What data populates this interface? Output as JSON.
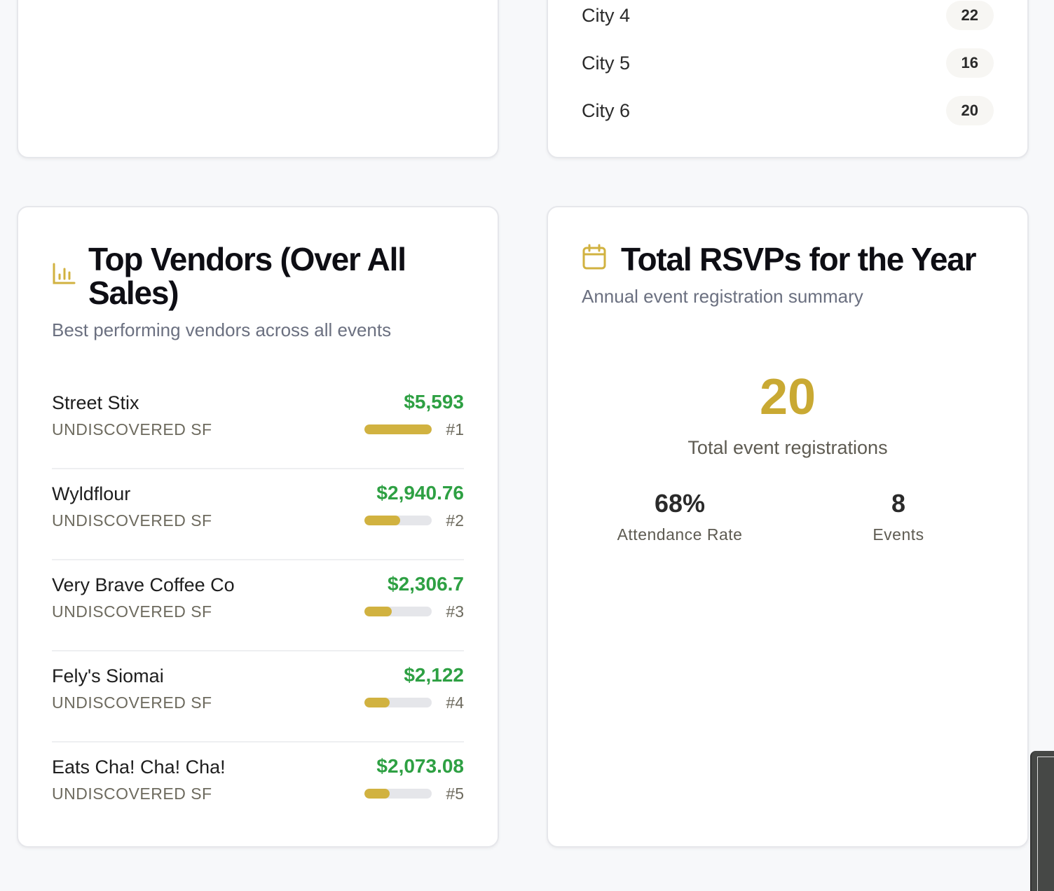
{
  "cities": [
    {
      "name": "City 4",
      "count": "22"
    },
    {
      "name": "City 5",
      "count": "16"
    },
    {
      "name": "City 6",
      "count": "20"
    }
  ],
  "vendors": {
    "title": "Top Vendors (Over All Sales)",
    "subtitle": "Best performing vendors across all events",
    "icon": "bar-chart-icon",
    "accent": "#d1b240",
    "items": [
      {
        "name": "Street Stix",
        "org": "UNDISCOVERED SF",
        "amount": "$5,593",
        "rank": "#1",
        "share": 1.0
      },
      {
        "name": "Wyldflour",
        "org": "UNDISCOVERED SF",
        "amount": "$2,940.76",
        "rank": "#2",
        "share": 0.53
      },
      {
        "name": "Very Brave Coffee Co",
        "org": "UNDISCOVERED SF",
        "amount": "$2,306.7",
        "rank": "#3",
        "share": 0.41
      },
      {
        "name": "Fely's Siomai",
        "org": "UNDISCOVERED SF",
        "amount": "$2,122",
        "rank": "#4",
        "share": 0.38
      },
      {
        "name": "Eats Cha! Cha! Cha!",
        "org": "UNDISCOVERED SF",
        "amount": "$2,073.08",
        "rank": "#5",
        "share": 0.37
      }
    ]
  },
  "rsvps": {
    "title": "Total RSVPs for the Year",
    "subtitle": "Annual event registration summary",
    "icon": "calendar-icon",
    "total": "20",
    "total_label": "Total event registrations",
    "attendance": "68%",
    "attendance_label": "Attendance Rate",
    "events": "8",
    "events_label": "Events"
  }
}
